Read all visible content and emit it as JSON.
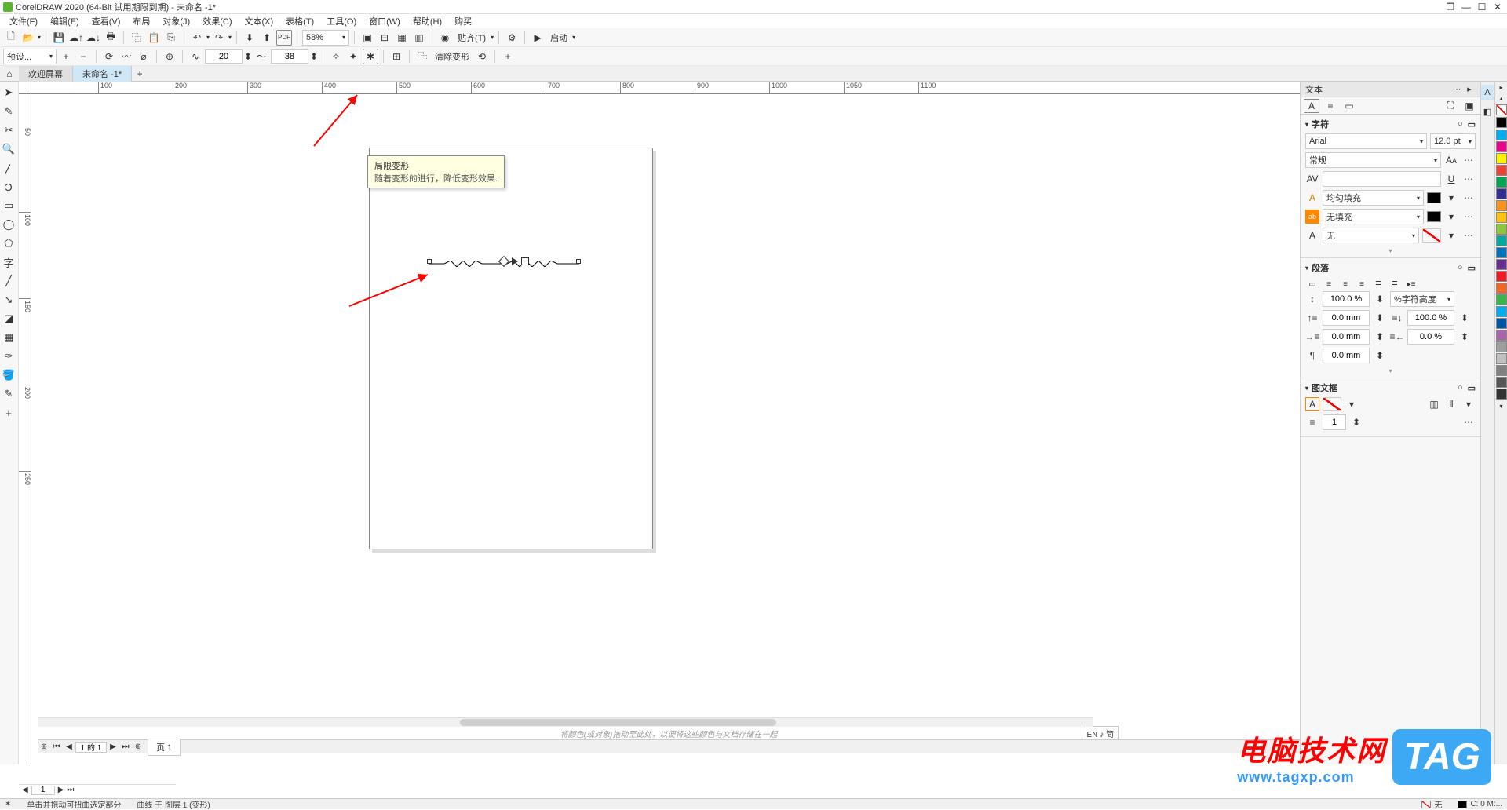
{
  "title": "CorelDRAW 2020 (64-Bit 试用期限到期) - 未命名 -1*",
  "menus": [
    "文件(F)",
    "编辑(E)",
    "查看(V)",
    "布局",
    "对象(J)",
    "效果(C)",
    "文本(X)",
    "表格(T)",
    "工具(O)",
    "窗口(W)",
    "帮助(H)",
    "购买"
  ],
  "toolbar1": {
    "zoom": "58%",
    "snap": "贴齐(T)",
    "launch": "启动"
  },
  "toolbar2": {
    "preset": "预设...",
    "amp": "20",
    "freq": "38",
    "clear": "清除变形"
  },
  "tabs": {
    "home": "欢迎屏幕",
    "doc": "未命名 -1*"
  },
  "tooltip": {
    "title": "局限变形",
    "desc": "随着变形的进行，降低变形效果."
  },
  "ruler_h": [
    "100",
    "200",
    "300",
    "400",
    "500",
    "600",
    "700",
    "800",
    "900",
    "1000",
    "1050",
    "1100"
  ],
  "ruler_v": [
    "50",
    "100",
    "150",
    "200",
    "250"
  ],
  "docker": {
    "title": "文本",
    "sec_char": "字符",
    "font": "Arial",
    "size": "12.0 pt",
    "weight": "常规",
    "fill_label": "均匀填充",
    "nofill_label": "无填充",
    "outline_none": "无",
    "sec_para": "段落",
    "line_height": "100.0 %",
    "line_height_label": "%字符高度",
    "before": "0.0 mm",
    "after_pct": "100.0 %",
    "spacing1": "0.0 mm",
    "spacing2": "0.0 %",
    "spacing3": "0.0 mm",
    "sec_frame": "图文框",
    "cols": "1"
  },
  "palette_colors": [
    "#00aeef",
    "#ec008c",
    "#fff200",
    "#ef4136",
    "#00a651",
    "#2e3192",
    "#f7941d",
    "#ffc20e",
    "#8dc63f",
    "#00a99d",
    "#0072bc",
    "#662d91",
    "#ed1c24",
    "#f26522",
    "#39b54a",
    "#00adef",
    "#0054a6",
    "#a864a8",
    "#9e9e9e",
    "#c0c0c0",
    "#808080",
    "#555555",
    "#333333"
  ],
  "page_nav": {
    "pos": "1 的 1",
    "tab": "页 1"
  },
  "jump_page": "1",
  "hint": "将颜色(或对象)拖动至此处，以便将这些颜色与文档存储在一起",
  "lang_indicator": "EN ♪ 简",
  "status": {
    "hint1": "单击并拖动可扭曲选定部分",
    "hint2": "曲线 于 图层 1   (变形)",
    "fill": "无",
    "outline_w": "C: 0  M:...",
    "none_label": "无"
  },
  "watermark": {
    "cn": "电脑技术网",
    "url": "www.tagxp.com",
    "tag": "TAG"
  }
}
